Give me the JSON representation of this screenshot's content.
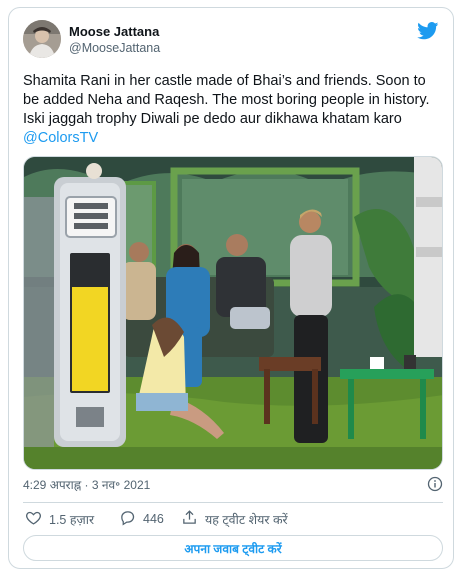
{
  "author": {
    "display_name": "Moose Jattana",
    "handle": "@MooseJattana"
  },
  "tweet": {
    "text": "Shamita Rani in her castle made of Bhai’s and friends. Soon to be added Neha and Raqesh. The most boring people in history. Iski jaggah trophy Diwali pe dedo aur dikhawa khatam karo ",
    "mention": "@ColorsTV"
  },
  "meta": {
    "timestamp": "4:29 अपराह्न · 3 नव॰ 2021"
  },
  "actions": {
    "like_count": "1.5 हज़ार",
    "reply_count": "446",
    "share_label": "यह ट्वीट शेयर करें"
  },
  "reply_button": {
    "label": "अपना जवाब ट्वीट करें"
  },
  "icons": {
    "brand": "twitter-bird-icon",
    "info": "info-icon",
    "like": "heart-icon",
    "reply": "comment-icon",
    "share": "share-icon"
  },
  "colors": {
    "brand": "#1d9bf0",
    "text": "#0f1419",
    "secondary": "#536471",
    "border": "#cfd9de"
  }
}
